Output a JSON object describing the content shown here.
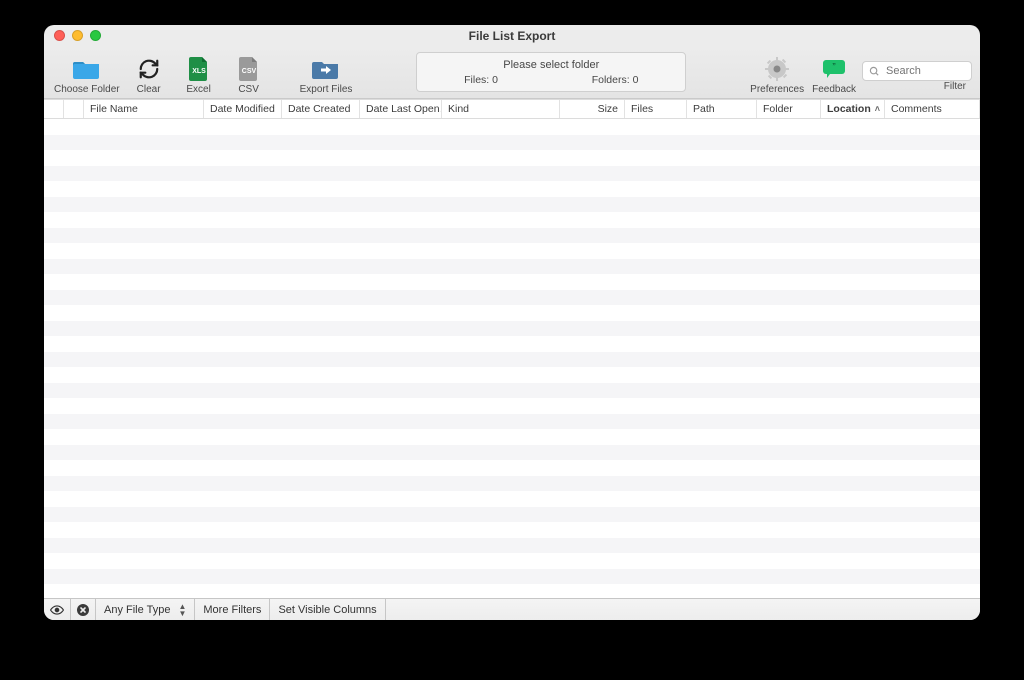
{
  "window": {
    "title": "File List Export"
  },
  "toolbar": {
    "choose_folder": "Choose Folder",
    "clear": "Clear",
    "excel": "Excel",
    "csv": "CSV",
    "export_files": "Export Files",
    "preferences": "Preferences",
    "feedback": "Feedback",
    "filter": "Filter"
  },
  "folder_well": {
    "prompt": "Please select folder",
    "files_label": "Files: 0",
    "folders_label": "Folders: 0"
  },
  "search": {
    "placeholder": "Search"
  },
  "columns": {
    "file_name": "File Name",
    "date_modified": "Date Modified",
    "date_created": "Date Created",
    "date_last_opened": "Date Last Open…",
    "kind": "Kind",
    "size": "Size",
    "files": "Files",
    "path": "Path",
    "folder": "Folder",
    "location": "Location",
    "comments": "Comments"
  },
  "sort": {
    "column": "location",
    "indicator": "˄"
  },
  "rows": 30,
  "bottom": {
    "any_file_type": "Any File Type",
    "more_filters": "More Filters",
    "set_visible_columns": "Set Visible Columns"
  }
}
